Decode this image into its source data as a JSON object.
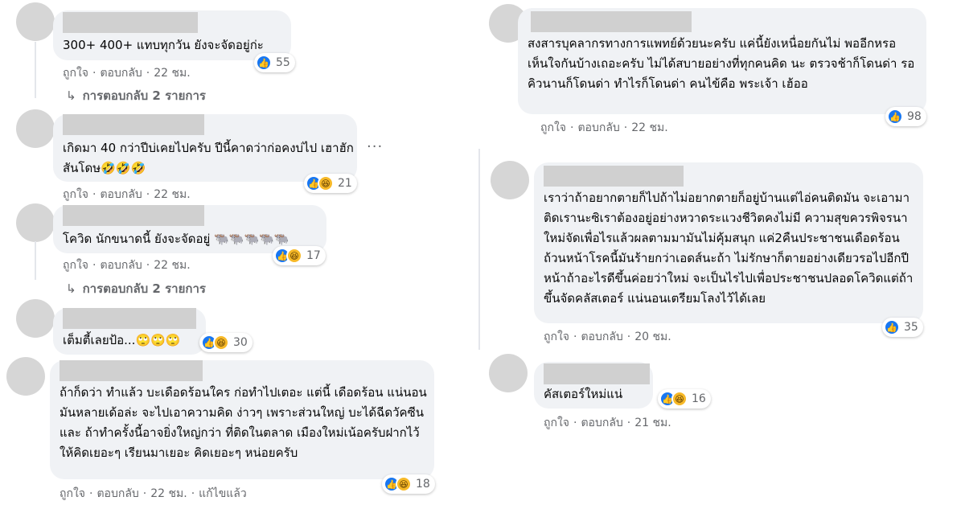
{
  "actions": {
    "like": "ถูกใจ",
    "reply": "ตอบกลับ",
    "edited": "แก้ไขแล้ว",
    "dot": "·"
  },
  "reply_link": "การตอบกลับ 2 รายการ",
  "more_label": "···",
  "comments_left": [
    {
      "text": "300+ 400+ แทบทุกวัน ยังจะจัดอยู่ก่ะ",
      "time": "22 ชม.",
      "reactions": [
        "like"
      ],
      "count": "55"
    },
    {
      "text": "เกิดมา 40 กว่าปีบ่เคยไปครับ ปีนี้คาดว่าก่อคงบ่ไป เฮาฮักสันโดษ🤣🤣🤣",
      "time": "22 ชม.",
      "reactions": [
        "like",
        "haha"
      ],
      "count": "21"
    },
    {
      "text": "โควิด นักขนาดนี้ ยังจะจัดอยู่ 🐃🐃🐃🐃🐃",
      "time": "22 ชม.",
      "reactions": [
        "like",
        "haha"
      ],
      "count": "17"
    },
    {
      "text": "เต็มตี้เลยป้อ...🙄🙄🙄",
      "time": "",
      "reactions": [
        "like",
        "haha"
      ],
      "count": "30"
    },
    {
      "text": "ถ้าก็ดว่า ทำแล้ว บะเดือดร้อนใคร ก่อทำไปเตอะ แต่นี้ เดือดร้อน แน่นอน มันหลายเด้อล่ะ จะไปเอาความคิด ง่าวๆ เพราะส่วนใหญ่ บะได้ฉีดวัคซีนและ ถ้าทำครั้งนี้อาจยิ่งใหญ่กว่า ที่ติดในตลาด เมืองใหม่เน้อครับฝากไว้ให้คิดเยอะๆ เรียนมาเยอะ คิดเยอะๆ หน่อยครับ",
      "time": "22 ชม.",
      "reactions": [
        "like",
        "haha"
      ],
      "count": "18"
    }
  ],
  "comments_right": [
    {
      "text": "สงสารบุคลากรทางการแพทย์ด้วยนะครับ แค่นี้ยังเหนื่อยกันไม่ พออีกหรอ เห็นใจกันบ้างเถอะครับ ไม่ได้สบายอย่างที่ทุกคนคิด นะ ตรวจช้าก็โดนด่า รอคิวนานก็โดนด่า ทำไรก็โดนด่า คนไข้คือ พระเจ้า เฮ้ออ",
      "time": "22 ชม.",
      "reactions": [
        "like"
      ],
      "count": "98"
    },
    {
      "text": "เราว่าถ้าอยากตายก็ไปถ้าไม่อยากตายก็อยู่บ้านแต่ไอ่คนติดมัน จะเอามาติดเรานะซิเราต้องอยู่อย่างหวาดระแวงชีวิตคงไม่มี ความสุขควรพิจรนาใหม่จัดเพื่อไรแล้วผลตามมามันไม่คุ้มสนุก แค่2คืนประชาชนเดือดร้อนถ้วนหน้าโรคนี้มันร้ายกว่าเอดส์นะถ้า ไม่รักษาก็ตายอย่างเดียวรอไปอีกปีหน้าถ้าอะไรดีขึ้นค่อยว่าใหม่ จะเป็นไรไปเพื่อประชาชนปลอดโควิดแต่ถ้าขึ้นจัดคลัสเตอร์ แน่นอนเตรียมโลงไว้ได้เลย",
      "time": "20 ชม.",
      "reactions": [
        "like"
      ],
      "count": "35"
    },
    {
      "text": "คัสเตอร์ใหม่แน่",
      "time": "21 ชม.",
      "reactions": [
        "like",
        "haha"
      ],
      "count": "16"
    }
  ],
  "colors": {
    "bubble": "#f0f2f5",
    "like": "#1877f2",
    "haha": "#f7b928",
    "meta": "#65676b"
  },
  "icons": {
    "like": "thumbs-up-icon",
    "haha": "laughing-face-icon",
    "reply_arrow": "reply-arrow-icon",
    "more": "more-options-icon"
  }
}
